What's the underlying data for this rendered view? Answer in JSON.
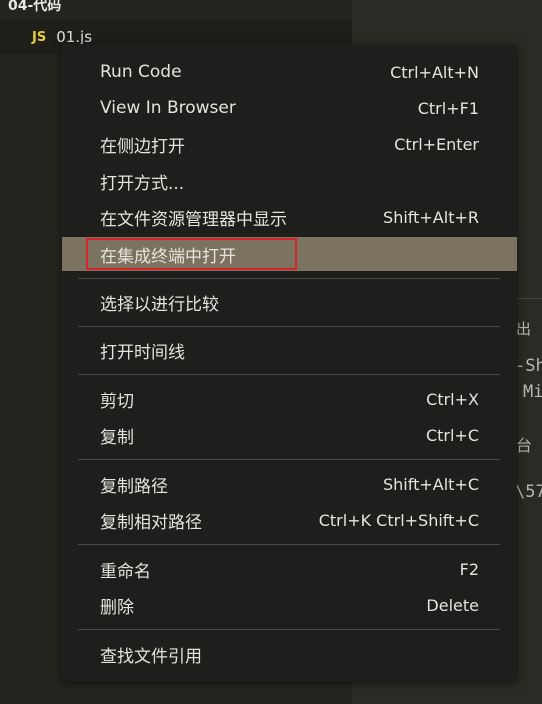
{
  "explorer": {
    "folder": "04-代码",
    "file": {
      "icon": "JS",
      "name": "01.js"
    }
  },
  "panel_fragments": [
    "出",
    "-Sh",
    "Mi",
    "台",
    "\\57"
  ],
  "context_menu": {
    "items": [
      {
        "label": "Run Code",
        "shortcut": "Ctrl+Alt+N"
      },
      {
        "label": "View In Browser",
        "shortcut": "Ctrl+F1"
      },
      {
        "label": "在侧边打开",
        "shortcut": "Ctrl+Enter"
      },
      {
        "label": "打开方式...",
        "shortcut": ""
      },
      {
        "label": "在文件资源管理器中显示",
        "shortcut": "Shift+Alt+R"
      },
      {
        "label": "在集成终端中打开",
        "shortcut": "",
        "highlighted": true
      },
      {
        "label": "选择以进行比较",
        "shortcut": ""
      },
      {
        "label": "打开时间线",
        "shortcut": ""
      },
      {
        "label": "剪切",
        "shortcut": "Ctrl+X"
      },
      {
        "label": "复制",
        "shortcut": "Ctrl+C"
      },
      {
        "label": "复制路径",
        "shortcut": "Shift+Alt+C"
      },
      {
        "label": "复制相对路径",
        "shortcut": "Ctrl+K Ctrl+Shift+C"
      },
      {
        "label": "重命名",
        "shortcut": "F2"
      },
      {
        "label": "删除",
        "shortcut": "Delete"
      },
      {
        "label": "查找文件引用",
        "shortcut": ""
      }
    ]
  },
  "colors": {
    "highlight": "#7b735f",
    "annotation_box": "#d8232a",
    "js_icon": "#e6cd3c"
  }
}
